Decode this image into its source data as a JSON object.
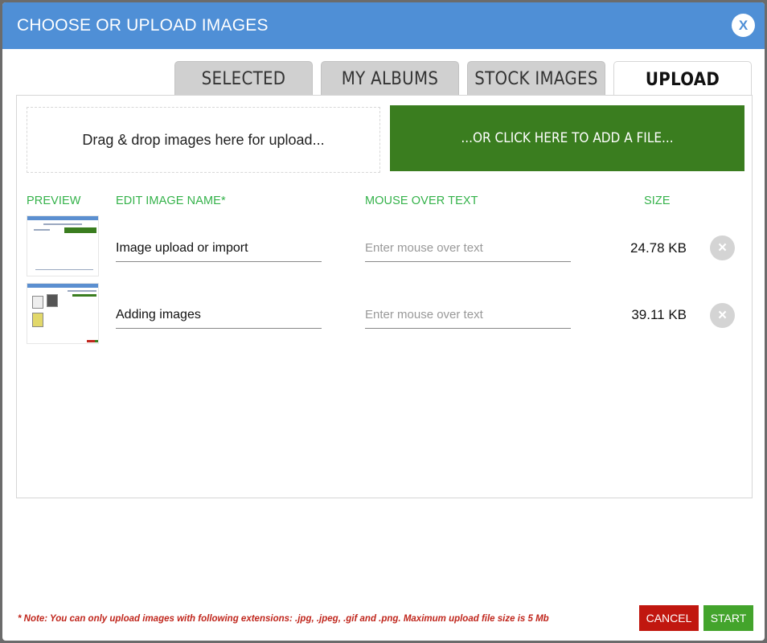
{
  "modal": {
    "title": "CHOOSE OR UPLOAD IMAGES",
    "close_label": "X"
  },
  "tabs": [
    {
      "label": "SELECTED",
      "active": false
    },
    {
      "label": "MY ALBUMS",
      "active": false
    },
    {
      "label": "STOCK IMAGES",
      "active": false
    },
    {
      "label": "UPLOAD",
      "active": true
    }
  ],
  "upload": {
    "dropzone_text": "Drag & drop images here for upload...",
    "add_file_label": "...OR CLICK HERE TO ADD A FILE..."
  },
  "table": {
    "headers": {
      "preview": "PREVIEW",
      "name": "EDIT IMAGE NAME*",
      "mouse_over": "MOUSE OVER TEXT",
      "size": "SIZE"
    },
    "rows": [
      {
        "name": "Image upload or import",
        "mouse_over_placeholder": "Enter mouse over text",
        "size": "24.78 KB",
        "remove_icon": "×"
      },
      {
        "name": "Adding images",
        "mouse_over_placeholder": "Enter mouse over text",
        "size": "39.11 KB",
        "remove_icon": "×"
      }
    ]
  },
  "footer": {
    "note": "* Note: You can only upload images with following extensions: .jpg, .jpeg, .gif and .png. Maximum upload file size is 5 Mb",
    "cancel_label": "CANCEL",
    "start_label": "START"
  },
  "colors": {
    "header": "#4f8fd6",
    "green_button": "#3a7d1f",
    "column_header": "#34b24a",
    "cancel": "#c1170f",
    "start": "#43a42c",
    "note": "#c0261c"
  }
}
